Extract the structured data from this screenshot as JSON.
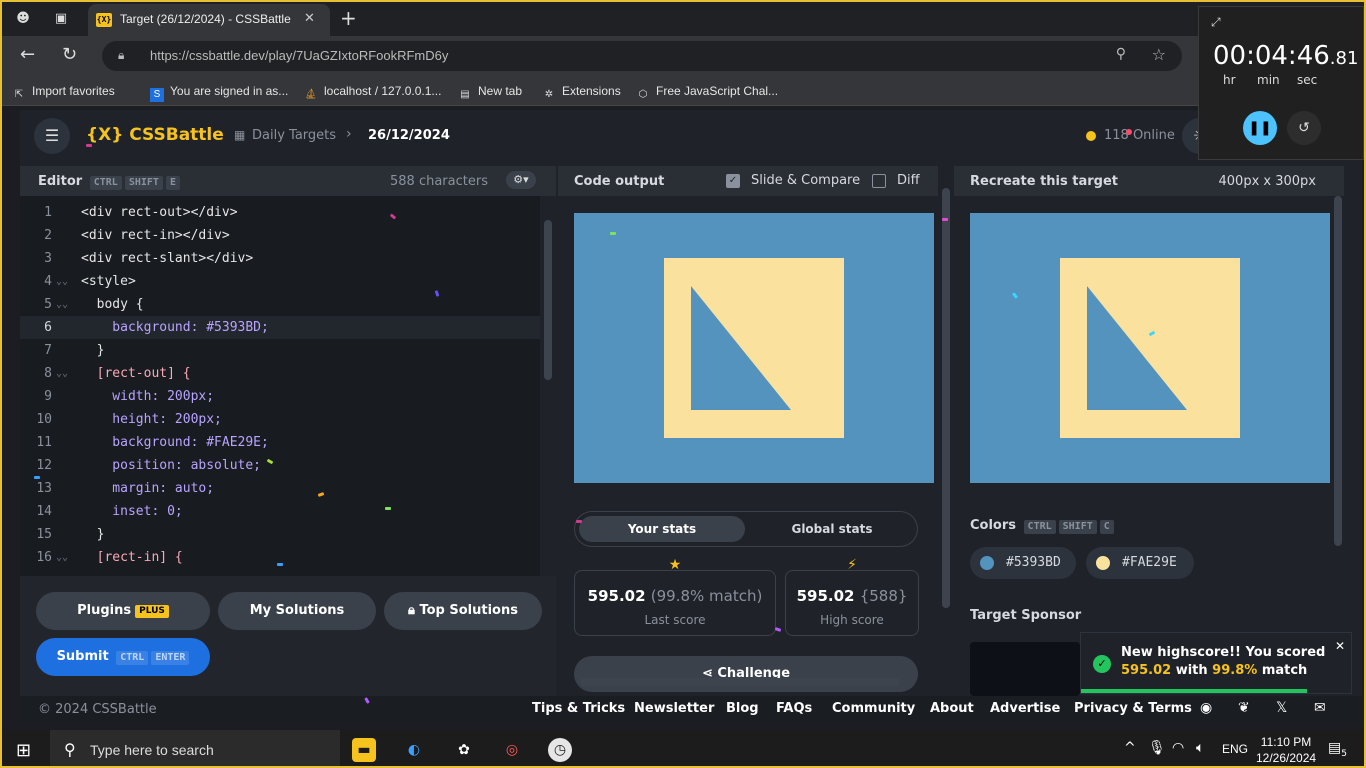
{
  "browser": {
    "tab_title": "Target (26/12/2024) - CSSBattle",
    "url": "https://cssbattle.dev/play/7UaGZIxtoRFookRFmD6y",
    "favorites": [
      "Import favorites",
      "You are signed in as...",
      "localhost / 127.0.0.1...",
      "New tab",
      "Extensions",
      "Free JavaScript Chal..."
    ]
  },
  "header": {
    "logo": "{X} CSSBattle",
    "crumb_daily": "Daily Targets",
    "crumb_date": "26/12/2024",
    "online": "118 Online"
  },
  "editor": {
    "title": "Editor",
    "shortcut": [
      "CTRL",
      "SHIFT",
      "E"
    ],
    "chars": "588 characters",
    "lines": [
      {
        "n": "1",
        "text": "<div rect-out></div>"
      },
      {
        "n": "2",
        "text": "<div rect-in></div>"
      },
      {
        "n": "3",
        "text": "<div rect-slant></div>"
      },
      {
        "n": "4",
        "text": "<style>"
      },
      {
        "n": "5",
        "text": "  body {"
      },
      {
        "n": "6",
        "text": "    background: #5393BD;"
      },
      {
        "n": "7",
        "text": "  }"
      },
      {
        "n": "8",
        "text": "  [rect-out] {"
      },
      {
        "n": "9",
        "text": "    width: 200px;"
      },
      {
        "n": "10",
        "text": "    height: 200px;"
      },
      {
        "n": "11",
        "text": "    background: #FAE29E;"
      },
      {
        "n": "12",
        "text": "    position: absolute;"
      },
      {
        "n": "13",
        "text": "    margin: auto;"
      },
      {
        "n": "14",
        "text": "    inset: 0;"
      },
      {
        "n": "15",
        "text": "  }"
      },
      {
        "n": "16",
        "text": "  [rect-in] {"
      }
    ],
    "buttons": {
      "plugins": "Plugins",
      "plugins_badge": "PLUS",
      "my_solutions": "My Solutions",
      "top_solutions": "Top Solutions",
      "submit": "Submit",
      "submit_keys": [
        "CTRL",
        "ENTER"
      ]
    }
  },
  "output": {
    "title": "Code output",
    "slide_compare": "Slide & Compare",
    "diff": "Diff",
    "stats_tab_yours": "Your stats",
    "stats_tab_global": "Global stats",
    "last_score": "595.02",
    "last_match": "(99.8% match)",
    "last_label": "Last score",
    "high_score": "595.02",
    "high_chars": "{588}",
    "high_label": "High score",
    "challenge": "Challenge"
  },
  "target": {
    "title": "Recreate this target",
    "size": "400px x 300px",
    "colors_title": "Colors",
    "colors_keys": [
      "CTRL",
      "SHIFT",
      "C"
    ],
    "colors": [
      {
        "hex": "#5393BD"
      },
      {
        "hex": "#FAE29E"
      }
    ],
    "sponsor_title": "Target Sponsor"
  },
  "footer": {
    "copyright": "© 2024 CSSBattle",
    "links": [
      "Tips & Tricks",
      "Newsletter",
      "Blog",
      "FAQs",
      "Community",
      "About",
      "Advertise",
      "Privacy & Terms"
    ]
  },
  "toast": {
    "title": "New highscore!! You scored",
    "score": "595.02",
    "with": "with",
    "match": "99.8%",
    "match_word": "match"
  },
  "stopwatch": {
    "time": "00:04:46",
    "ms": ".81",
    "units": [
      "hr",
      "min",
      "sec"
    ]
  },
  "taskbar": {
    "search_placeholder": "Type here to search",
    "lang": "ENG",
    "time": "11:10 PM",
    "date": "12/26/2024",
    "notif_count": "5"
  },
  "colors": {
    "accent": "#f6c21e",
    "bg": "#5393bd",
    "shape": "#fae29e",
    "submit": "#1e6fe0"
  }
}
